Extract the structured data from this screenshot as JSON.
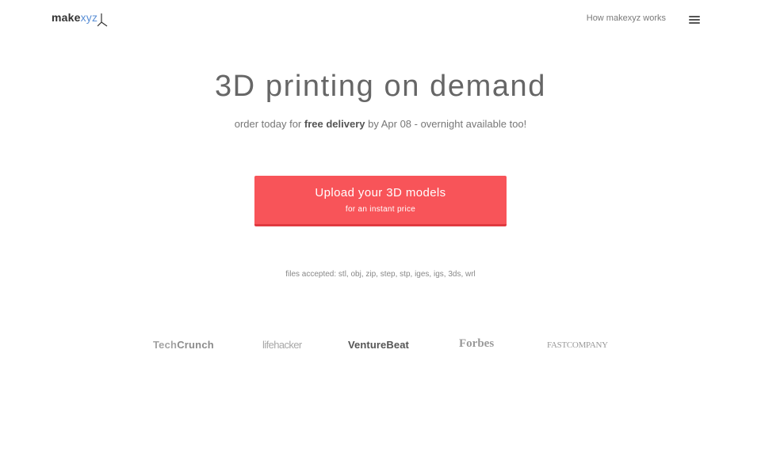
{
  "header": {
    "logo_make": "make",
    "logo_xyz": "xyz",
    "nav_link": "How makexyz works",
    "menu_icon": "hamburger-menu-icon"
  },
  "hero": {
    "title": "3D printing on demand",
    "subtitle_pre": "order today for ",
    "subtitle_strong": "free delivery",
    "subtitle_post": " by Apr 08 - overnight available too!"
  },
  "upload": {
    "main_label": "Upload your 3D models",
    "sub_label": "for an instant price",
    "color": "#f85459"
  },
  "files": {
    "accepted_text": "files accepted: stl, obj, zip, step, stp, iges, igs, 3ds, wrl"
  },
  "press": {
    "techcrunch_a": "Tech",
    "techcrunch_b": "Crunch",
    "lifehacker": "lifehacker",
    "venturebeat": "VentureBeat",
    "forbes": "Forbes",
    "fastcompany": "FASTCOMPANY"
  }
}
